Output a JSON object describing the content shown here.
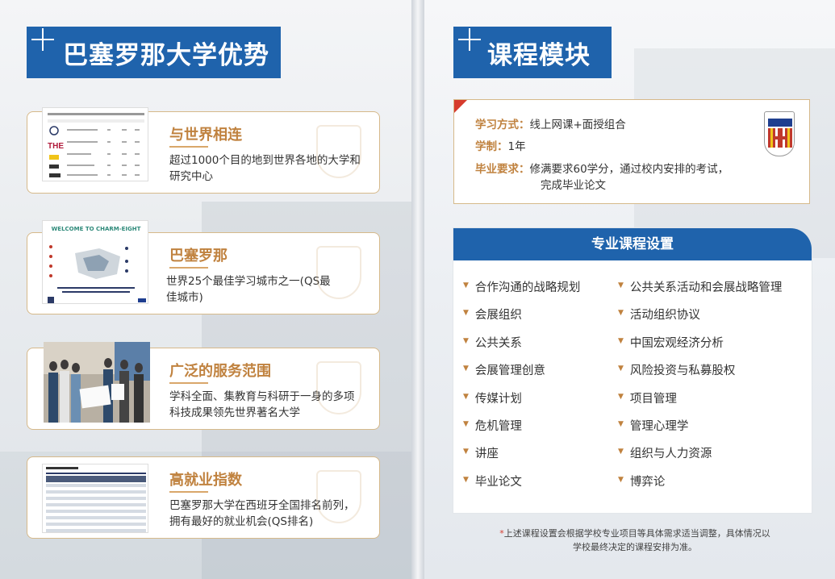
{
  "left": {
    "title": "巴塞罗那大学优势",
    "cards": [
      {
        "heading": "与世界相连",
        "text": "超过1000个目的地到世界各地的大学和研究中心"
      },
      {
        "heading": "巴塞罗那",
        "text": "世界25个最佳学习城市之一(QS最佳城市)"
      },
      {
        "heading": "广泛的服务范围",
        "text": "学科全面、集教育与科研于一身的多项科技成果领先世界著名大学"
      },
      {
        "heading": "高就业指数",
        "text": "巴塞罗那大学在西班牙全国排名前列，拥有最好的就业机会(QS排名)"
      }
    ],
    "thumb2_caption": "WELCOME TO CHARM-EIGHT"
  },
  "right": {
    "title": "课程模块",
    "study_mode_label": "学习方式：",
    "study_mode_value": "线上网课+面授组合",
    "duration_label": "学制：",
    "duration_value": "1年",
    "grad_label": "毕业要求：",
    "grad_value_1": "修满要求60学分，通过校内安排的考试，",
    "grad_value_2": "完成毕业论文",
    "course_header": "专业课程设置",
    "courses_left": [
      "合作沟通的战略规划",
      "会展组织",
      "公共关系",
      "会展管理创意",
      "传媒计划",
      "危机管理",
      "讲座",
      "毕业论文"
    ],
    "courses_right": [
      "公共关系活动和会展战略管理",
      "活动组织协议",
      "中国宏观经济分析",
      "风险投资与私募股权",
      "项目管理",
      "管理心理学",
      "组织与人力资源",
      "博弈论"
    ],
    "footnote_mark": "*",
    "footnote_1": "上述课程设置会根据学校专业项目等具体需求适当调整，具体情况以",
    "footnote_2": "学校最终决定的课程安排为准。"
  },
  "colors": {
    "brand_blue": "#1f63ac",
    "accent_gold": "#c0823f",
    "red": "#d63b2d"
  }
}
